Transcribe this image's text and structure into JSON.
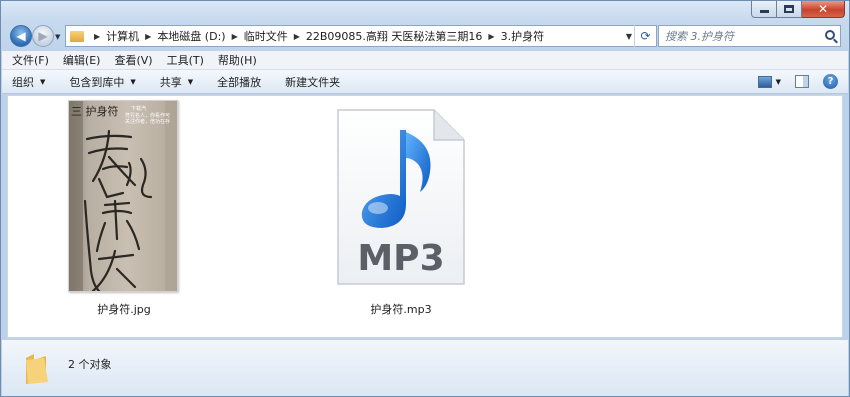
{
  "window": {
    "breadcrumbs": [
      "计算机",
      "本地磁盘 (D:)",
      "临时文件",
      "22B09085.高翔 天医秘法第三期16",
      "3.护身符"
    ],
    "search_placeholder": "搜索 3.护身符"
  },
  "menu": [
    "文件(F)",
    "编辑(E)",
    "查看(V)",
    "工具(T)",
    "帮助(H)"
  ],
  "commands": {
    "organize": "组织",
    "include_library": "包含到库中",
    "share": "共享",
    "play_all": "全部播放",
    "new_folder": "新建文件夹"
  },
  "files": [
    {
      "name": "护身符.jpg",
      "icon": "image-thumbnail"
    },
    {
      "name": "护身符.mp3",
      "icon": "mp3-file-icon",
      "badge": "MP3"
    }
  ],
  "status": {
    "count_text": "2 个对象"
  },
  "thumbnail_text": {
    "title": "三 护身符",
    "sign": "下载汽",
    "note1": "符咒名人，你看作可",
    "note2": "关注你者，倍功在存"
  },
  "colors": {
    "accent": "#2b6bb5",
    "note_blue": "#1d73d6",
    "close": "#c7442d"
  }
}
